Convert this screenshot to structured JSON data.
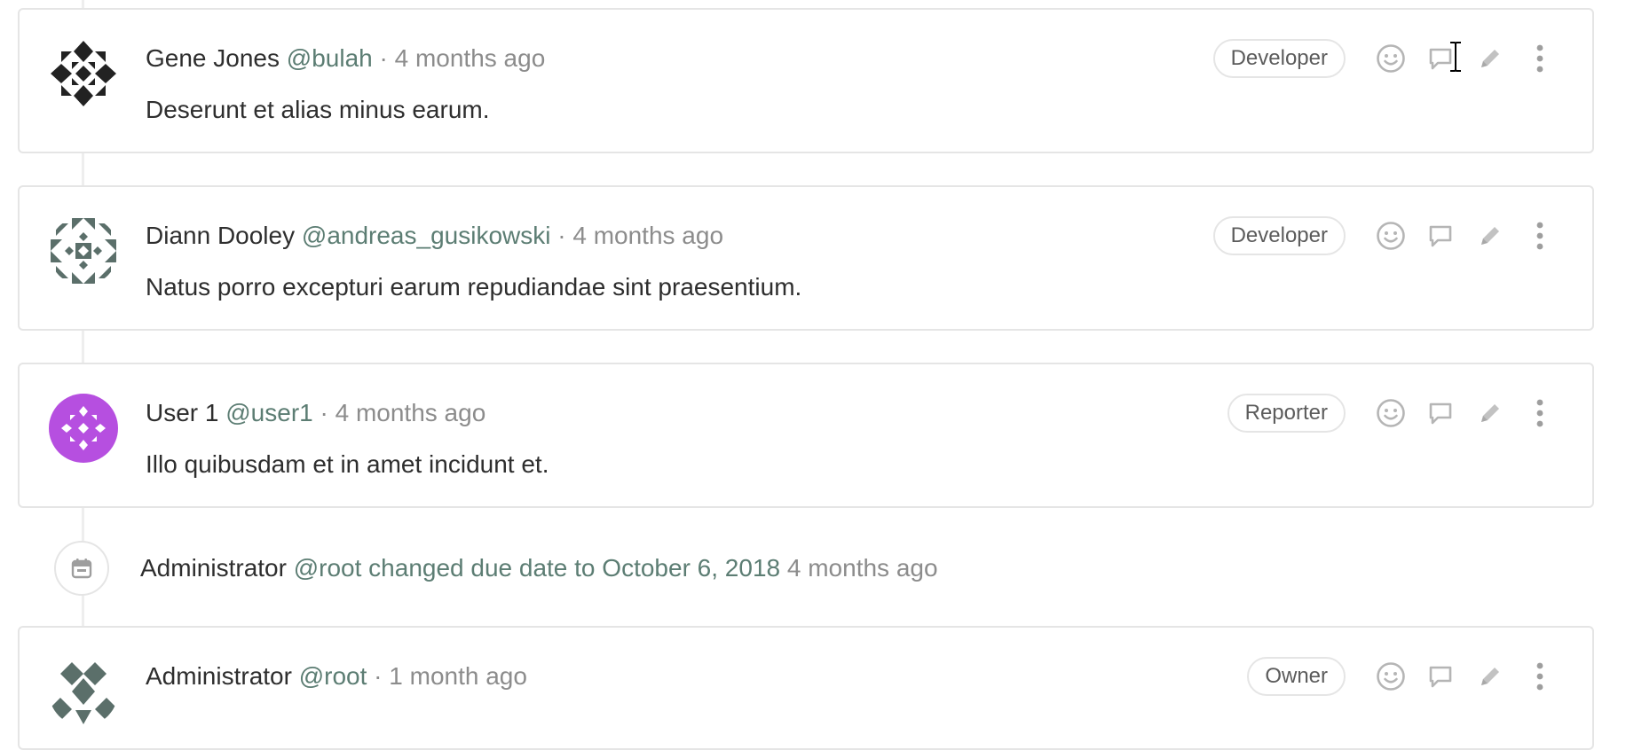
{
  "notes": [
    {
      "author": "Gene Jones",
      "username": "@bulah",
      "separator": "·",
      "time": "4 months ago",
      "body": "Deserunt et alias minus earum.",
      "role": "Developer",
      "avatar_color": "#222222"
    },
    {
      "author": "Diann Dooley",
      "username": "@andreas_gusikowski",
      "separator": "·",
      "time": "4 months ago",
      "body": "Natus porro excepturi earum repudiandae sint praesentium.",
      "role": "Developer",
      "avatar_color": "#5b6f6a"
    },
    {
      "author": "User 1",
      "username": "@user1",
      "separator": "·",
      "time": "4 months ago",
      "body": "Illo quibusdam et in amet incidunt et.",
      "role": "Reporter",
      "avatar_color": "#b64fe0"
    },
    {
      "author": "Administrator",
      "username": "@root",
      "separator": "·",
      "time": "1 month ago",
      "body": "",
      "role": "Owner",
      "avatar_color": "#5b6f6a"
    }
  ],
  "system_note": {
    "author": "Administrator",
    "username": "@root",
    "action": "changed due date to October 6, 2018",
    "time": "4 months ago",
    "icon": "calendar-icon"
  },
  "icons": {
    "emoji": "smiley-icon",
    "reply": "comment-icon",
    "edit": "pencil-icon",
    "more": "kebab-icon"
  },
  "colors": {
    "username": "#5c7d73",
    "muted": "#8c8c8c",
    "border": "#e5e5e5",
    "icon": "#b5b5b5"
  }
}
